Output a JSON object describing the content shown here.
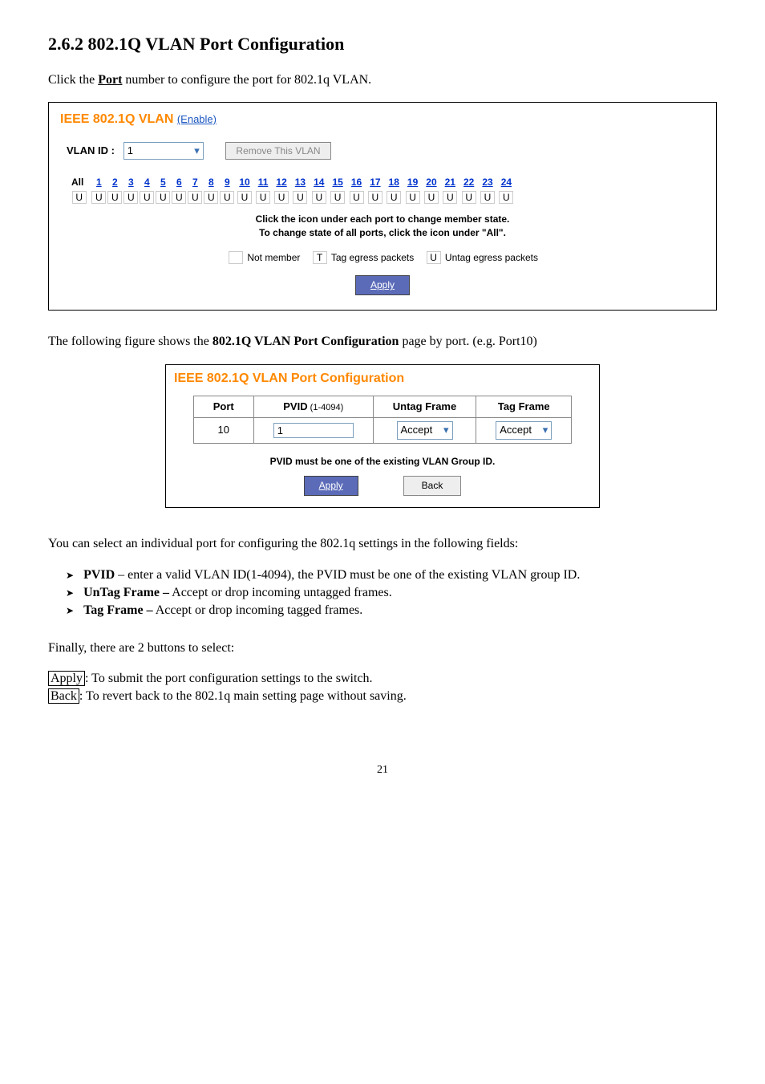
{
  "heading": "2.6.2   802.1Q VLAN Port Configuration",
  "intro_pre": "Click the ",
  "intro_port": "Port",
  "intro_post": " number to configure the port for 802.1q VLAN.",
  "box1": {
    "title": "IEEE 802.1Q VLAN ",
    "enable": "(Enable)",
    "vlanid_label": "VLAN ID :",
    "vlanid_value": "1",
    "remove_btn": "Remove This VLAN",
    "all_label": "All",
    "ports": [
      "1",
      "2",
      "3",
      "4",
      "5",
      "6",
      "7",
      "8",
      "9",
      "10",
      "11",
      "12",
      "13",
      "14",
      "15",
      "16",
      "17",
      "18",
      "19",
      "20",
      "21",
      "22",
      "23",
      "24"
    ],
    "u_val": "U",
    "note_line1": "Click the icon under each port to change member state.",
    "note_line2": "To change state of all ports, click the icon under \"All\".",
    "legend_notmember": "Not member",
    "legend_t": "T",
    "legend_tag": "Tag egress packets",
    "legend_u": "U",
    "legend_untag": "Untag egress packets",
    "apply": "Apply"
  },
  "mid_para_pre": "The following figure shows the ",
  "mid_para_bold": "802.1Q VLAN Port Configuration",
  "mid_para_post": " page by port. (e.g. Port10)",
  "box2": {
    "title": "IEEE 802.1Q VLAN Port Configuration",
    "col_port": "Port",
    "col_pvid": "PVID",
    "col_pvid_range": " (1-4094)",
    "col_untag": "Untag Frame",
    "col_tag": "Tag Frame",
    "port_val": "10",
    "pvid_val": "1",
    "untag_val": "Accept",
    "tag_val": "Accept",
    "note": "PVID must be one of the existing VLAN Group ID.",
    "apply": "Apply",
    "back": "Back"
  },
  "fields_intro": "You can select an individual port for configuring the 802.1q settings in the following fields:",
  "bullet_pvid_b": "PVID",
  "bullet_pvid_t": " – enter a valid VLAN ID(1-4094), the PVID must be one of the existing VLAN group ID.",
  "bullet_untag_b": "UnTag Frame –",
  "bullet_untag_t": " Accept or drop incoming untagged frames.",
  "bullet_tag_b": "Tag Frame –",
  "bullet_tag_t": " Accept or drop incoming tagged frames.",
  "finally": "Finally, there are 2 buttons to select:",
  "apply_word": "Apply",
  "apply_expl": ": To submit the port configuration settings to the switch.",
  "back_word": "Back",
  "back_expl": ": To revert back to the 802.1q main setting page without saving.",
  "page_number": "21"
}
